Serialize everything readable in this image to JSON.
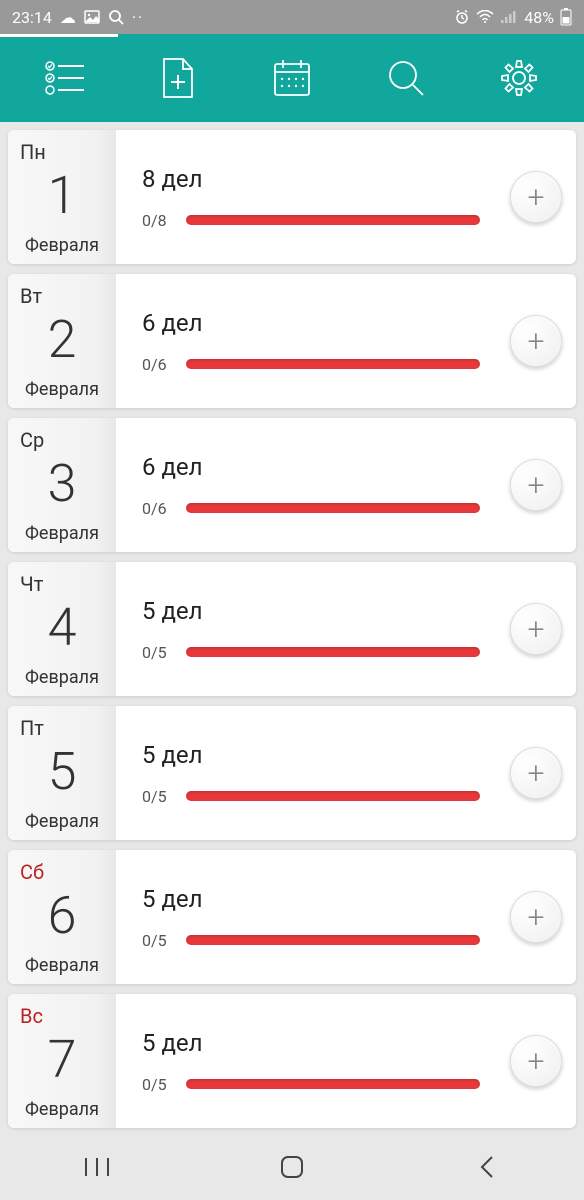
{
  "statusbar": {
    "time": "23:14",
    "battery": "48%"
  },
  "days": [
    {
      "weekday": "Пн",
      "date": "1",
      "month": "Февраля",
      "tasks": "8 дел",
      "progress": "0/8",
      "weekend": false
    },
    {
      "weekday": "Вт",
      "date": "2",
      "month": "Февраля",
      "tasks": "6 дел",
      "progress": "0/6",
      "weekend": false
    },
    {
      "weekday": "Ср",
      "date": "3",
      "month": "Февраля",
      "tasks": "6 дел",
      "progress": "0/6",
      "weekend": false
    },
    {
      "weekday": "Чт",
      "date": "4",
      "month": "Февраля",
      "tasks": "5 дел",
      "progress": "0/5",
      "weekend": false
    },
    {
      "weekday": "Пт",
      "date": "5",
      "month": "Февраля",
      "tasks": "5 дел",
      "progress": "0/5",
      "weekend": false
    },
    {
      "weekday": "Сб",
      "date": "6",
      "month": "Февраля",
      "tasks": "5 дел",
      "progress": "0/5",
      "weekend": true
    },
    {
      "weekday": "Вс",
      "date": "7",
      "month": "Февраля",
      "tasks": "5 дел",
      "progress": "0/5",
      "weekend": true
    }
  ]
}
